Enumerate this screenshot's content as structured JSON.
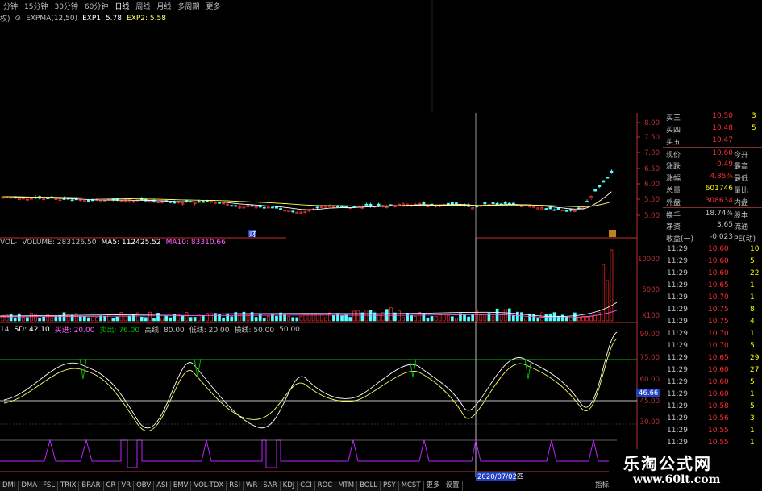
{
  "period_tabs": [
    {
      "label": "分钟",
      "active": false
    },
    {
      "label": "15分钟",
      "active": false
    },
    {
      "label": "30分钟",
      "active": false
    },
    {
      "label": "60分钟",
      "active": false
    },
    {
      "label": "日线",
      "active": true
    },
    {
      "label": "周线",
      "active": false
    },
    {
      "label": "月线",
      "active": false
    },
    {
      "label": "多周期",
      "active": false
    },
    {
      "label": "更多",
      "active": false
    }
  ],
  "main_legend": {
    "prefix": "权)",
    "name": "EXPMA(12,50)",
    "exp1": "EXP1: 5.78",
    "exp2": "EXP2: 5.58"
  },
  "vol_legend": {
    "name": "VOL-",
    "volume": "VOLUME: 283126.50",
    "ma5": "MA5: 112425.52",
    "ma10": "MA10: 83310.66"
  },
  "kd_legend": {
    "prefix": "14",
    "sd": "SD: 42.10",
    "buy": "买进: 20.00",
    "sell": "卖出: 76.00",
    "hi": "高线: 80.00",
    "lo": "低线: 20.00",
    "mid": "横线: 50.00",
    "extra": "50.00"
  },
  "price_axis": {
    "labels": [
      "8.00",
      "7.50",
      "7.00",
      "6.50",
      "6.00",
      "5.50",
      "5.00"
    ]
  },
  "vol_axis": {
    "labels": [
      "10000",
      "5000",
      "X100"
    ]
  },
  "kd_axis": {
    "labels": [
      "90.00",
      "75.00",
      "60.00",
      "46.66",
      "45.00",
      "30.00"
    ]
  },
  "date_marker": "2020/07/02四",
  "marker_low_label": "财",
  "colors": {
    "up": "#ff3030",
    "down": "#54ffff",
    "exp1": "#ffffff",
    "exp2": "#ffff60",
    "k": "#ffffff",
    "d": "#ffff60",
    "green": "#00c000",
    "purple": "#c020ff",
    "axis": "#c03030"
  },
  "quote": {
    "rows": [
      {
        "lab": "买三",
        "val": "10.50",
        "lab2": "",
        "val2": "3",
        "color": "#ff3030"
      },
      {
        "lab": "买四",
        "val": "10.48",
        "lab2": "",
        "val2": "5",
        "color": "#ff3030"
      },
      {
        "lab": "买五",
        "val": "10.47",
        "lab2": "",
        "val2": "",
        "color": "#ff3030"
      },
      {
        "lab": "现价",
        "val": "10.60",
        "lab2": "今开",
        "val2": "",
        "color": "#ff3030"
      },
      {
        "lab": "涨跌",
        "val": "0.49",
        "lab2": "最高",
        "val2": "",
        "color": "#ff3030"
      },
      {
        "lab": "涨幅",
        "val": "4.85%",
        "lab2": "最低",
        "val2": "",
        "color": "#ff3030"
      },
      {
        "lab": "总量",
        "val": "601746",
        "lab2": "量比",
        "val2": "",
        "color": "#ffff00"
      },
      {
        "lab": "外盘",
        "val": "308634",
        "lab2": "内盘",
        "val2": "",
        "color": "#ff3030"
      },
      {
        "lab": "换手",
        "val": "18.74%",
        "lab2": "股本",
        "val2": "",
        "color": "#c0c0c0"
      },
      {
        "lab": "净资",
        "val": "3.65",
        "lab2": "流通",
        "val2": "",
        "color": "#c0c0c0"
      },
      {
        "lab": "收益(一)",
        "val": "-0.023",
        "lab2": "PE(动)",
        "val2": "",
        "color": "#c0c0c0"
      }
    ]
  },
  "ticks": [
    {
      "t": "11:29",
      "p": "10.60",
      "v": "10"
    },
    {
      "t": "11:29",
      "p": "10.60",
      "v": "5"
    },
    {
      "t": "11:29",
      "p": "10.60",
      "v": "22"
    },
    {
      "t": "11:29",
      "p": "10.65",
      "v": "1"
    },
    {
      "t": "11:29",
      "p": "10.70",
      "v": "1"
    },
    {
      "t": "11:29",
      "p": "10.75",
      "v": "8"
    },
    {
      "t": "11:29",
      "p": "10.75",
      "v": "4"
    },
    {
      "t": "11:29",
      "p": "10.70",
      "v": "1"
    },
    {
      "t": "11:29",
      "p": "10.70",
      "v": "5"
    },
    {
      "t": "11:29",
      "p": "10.65",
      "v": "29"
    },
    {
      "t": "11:29",
      "p": "10.60",
      "v": "27"
    },
    {
      "t": "11:29",
      "p": "10.60",
      "v": "5"
    },
    {
      "t": "11:29",
      "p": "10.60",
      "v": "1"
    },
    {
      "t": "11:29",
      "p": "10.58",
      "v": "5"
    },
    {
      "t": "11:29",
      "p": "10.56",
      "v": "3"
    },
    {
      "t": "11:29",
      "p": "10.55",
      "v": "1"
    },
    {
      "t": "11:29",
      "p": "10.55",
      "v": "1"
    }
  ],
  "bottom_tabs": [
    "DMI",
    "DMA",
    "FSL",
    "TRIX",
    "BRAR",
    "CR",
    "VR",
    "OBV",
    "ASI",
    "EMV",
    "VOL-TDX",
    "RSI",
    "WR",
    "SAR",
    "KDJ",
    "CCI",
    "ROC",
    "MTM",
    "BOLL",
    "PSY",
    "MCST",
    "更多",
    "设置"
  ],
  "bottom_tabs_extra": "指标",
  "watermark": {
    "title": "乐淘公式网",
    "url": "www.60lt.com"
  }
}
